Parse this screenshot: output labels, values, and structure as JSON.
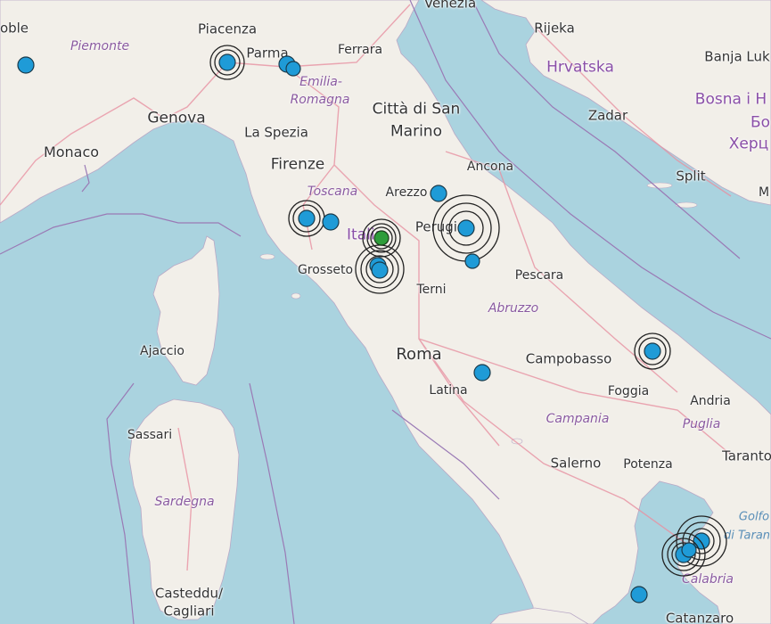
{
  "map": {
    "countries": [
      "Hrvatska",
      "Bosna i H",
      "Бо",
      "Херц",
      "Italia"
    ],
    "regions": [
      "Piemonte",
      "Emilia-",
      "Romagna",
      "Toscana",
      "Abruzzo",
      "Campania",
      "Puglia",
      "Sardegna",
      "Calabria"
    ],
    "cities": [
      "Venezia",
      "Piacenza",
      "Parma",
      "Ferrara",
      "Rijeka",
      "Banja Luk",
      "Genova",
      "La Spezia",
      "Città di San",
      "Marino",
      "Monaco",
      "Firenze",
      "Ancona",
      "Zadar",
      "Split",
      "Arezzo",
      "Perugia",
      "Grosseto",
      "Pescara",
      "Terni",
      "Ajaccio",
      "Roma",
      "Campobasso",
      "Latina",
      "Foggia",
      "Andria",
      "Sassari",
      "Salerno",
      "Potenza",
      "Taranto",
      "Casteddu/",
      "Cagliari",
      "Catanzaro",
      "oble",
      "M"
    ],
    "sea_labels": [
      "Golfo",
      "di Taran"
    ]
  },
  "colors": {
    "sea": "#aad3df",
    "land": "#f2efe9",
    "event_marker": "#1f9bd7",
    "latest_event_marker": "#2e9d3a"
  },
  "icons": {
    "event": "earthquake-epicenter-icon",
    "rings": "magnitude-ring-icon"
  },
  "events": [
    {
      "id": "e1"
    },
    {
      "id": "e2"
    },
    {
      "id": "e3"
    },
    {
      "id": "e4"
    },
    {
      "id": "e5"
    },
    {
      "id": "e6"
    },
    {
      "id": "e7"
    },
    {
      "id": "e8"
    },
    {
      "id": "e9"
    },
    {
      "id": "e10"
    },
    {
      "id": "e11"
    },
    {
      "id": "e12"
    },
    {
      "id": "e13"
    },
    {
      "id": "e14"
    },
    {
      "id": "e15"
    },
    {
      "id": "e16"
    },
    {
      "id": "e17"
    }
  ]
}
